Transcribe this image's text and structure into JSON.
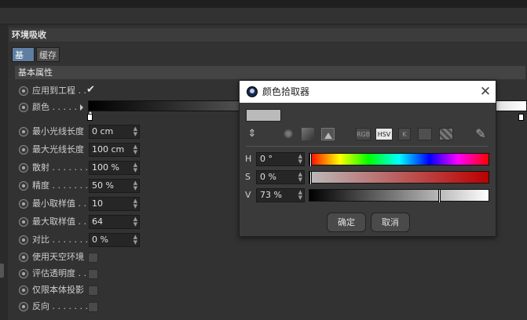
{
  "panel": {
    "title": "环境吸收",
    "tabs": [
      "基本",
      "缓存"
    ],
    "section_title": "基本属性"
  },
  "properties": {
    "apply_to_project": {
      "label": "应用到工程 . .",
      "checked": true,
      "check_glyph": "✔"
    },
    "color": {
      "label": "颜色 . . . . . ."
    },
    "min_ray_length": {
      "label": "最小光线长度",
      "value": "0 cm"
    },
    "max_ray_length": {
      "label": "最大光线长度",
      "value": "100 cm"
    },
    "dispersion": {
      "label": "散射 . . . . . . .",
      "value": "100 %"
    },
    "accuracy": {
      "label": "精度 . . . . . . .",
      "value": "50 %"
    },
    "min_samples": {
      "label": "最小取样值 . .",
      "value": "10"
    },
    "max_samples": {
      "label": "最大取样值 . .",
      "value": "64"
    },
    "contrast": {
      "label": "对比 . . . . . . .",
      "value": "0 %"
    },
    "use_sky": {
      "label": "使用天空环境"
    },
    "evaluate_transparency": {
      "label": "评估透明度 . ."
    },
    "self_shadowing_only": {
      "label": "仅限本体投影"
    },
    "invert": {
      "label": "反向 . . . . . . ."
    }
  },
  "dialog": {
    "title": "颜色拾取器",
    "close_glyph": "✕",
    "modes": {
      "rgb": "RGB",
      "hsv": "HSV",
      "k": "K"
    },
    "h": {
      "label": "H",
      "value": "0 °",
      "fraction": 0.0
    },
    "s": {
      "label": "S",
      "value": "0 %",
      "fraction": 0.0
    },
    "v": {
      "label": "V",
      "value": "73 %",
      "fraction": 0.73
    },
    "current_color": "#bababa",
    "ok_label": "确定",
    "cancel_label": "取消"
  },
  "colors": {
    "active_tab": "#5e7fa2",
    "panel_bg": "#323232"
  },
  "icons": {
    "spin": "⇕",
    "wheel": "✺",
    "eyedropper": "⁄"
  }
}
